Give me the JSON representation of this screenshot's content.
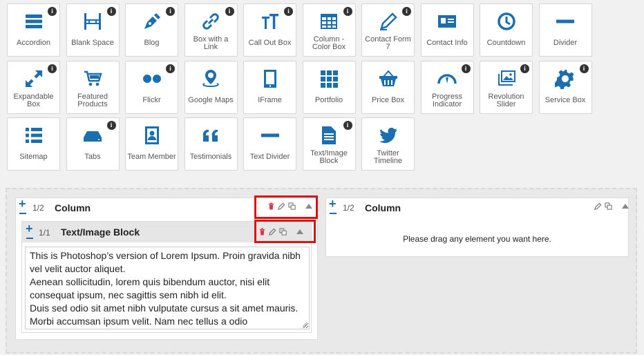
{
  "palette": [
    {
      "label": "Accordion",
      "icon": "accordion-icon",
      "info": true
    },
    {
      "label": "Blank Space",
      "icon": "blank-space-icon",
      "info": true
    },
    {
      "label": "Blog",
      "icon": "blog-pen-icon",
      "info": true
    },
    {
      "label": "Box with a Link",
      "icon": "link-icon",
      "info": true
    },
    {
      "label": "Call Out Box",
      "icon": "text-size-icon",
      "info": true
    },
    {
      "label": "Column - Color Box",
      "icon": "table-grid-icon",
      "info": true
    },
    {
      "label": "Contact Form 7",
      "icon": "pencil-icon",
      "info": true
    },
    {
      "label": "Contact Info",
      "icon": "contact-card-icon",
      "info": false
    },
    {
      "label": "Countdown",
      "icon": "clock-icon",
      "info": false
    },
    {
      "label": "Divider",
      "icon": "minus-bar-icon",
      "info": false
    },
    {
      "label": "Expandable Box",
      "icon": "expand-arrows-icon",
      "info": true
    },
    {
      "label": "Featured Products",
      "icon": "cart-icon",
      "info": false
    },
    {
      "label": "Flickr",
      "icon": "flickr-dots-icon",
      "info": true
    },
    {
      "label": "Google Maps",
      "icon": "map-pin-icon",
      "info": false
    },
    {
      "label": "IFrame",
      "icon": "tablet-icon",
      "info": false
    },
    {
      "label": "Portfolio",
      "icon": "grid-squares-icon",
      "info": false
    },
    {
      "label": "Price Box",
      "icon": "basket-icon",
      "info": false
    },
    {
      "label": "Progress Indicator",
      "icon": "gauge-icon",
      "info": true
    },
    {
      "label": "Revolution Slider",
      "icon": "images-icon",
      "info": true
    },
    {
      "label": "Service Box",
      "icon": "gear-icon",
      "info": true
    },
    {
      "label": "Sitemap",
      "icon": "list-icon",
      "info": false
    },
    {
      "label": "Tabs",
      "icon": "drive-icon",
      "info": true
    },
    {
      "label": "Team Member",
      "icon": "person-badge-icon",
      "info": false
    },
    {
      "label": "Testimonials",
      "icon": "quote-icon",
      "info": false
    },
    {
      "label": "Text Divider",
      "icon": "minus-bar-icon",
      "info": false
    },
    {
      "label": "Text/Image Block",
      "icon": "document-icon",
      "info": true
    },
    {
      "label": "Twitter Timeline",
      "icon": "twitter-bird-icon",
      "info": false
    }
  ],
  "left_column": {
    "fraction": "1/2",
    "title": "Column"
  },
  "right_column": {
    "fraction": "1/2",
    "title": "Column",
    "empty_message": "Please drag any element you want here."
  },
  "block": {
    "fraction": "1/1",
    "title": "Text/Image Block",
    "content": "This is Photoshop’s version of Lorem Ipsum. Proin gravida nibh vel velit auctor aliquet.\nAenean sollicitudin, lorem quis bibendum auctor, nisi elit consequat ipsum, nec sagittis sem nibh id elit.\nDuis sed odio sit amet nibh vulputate cursus a sit amet mauris. Morbi accumsan ipsum velit. Nam nec tellus a odio"
  },
  "colors": {
    "accent": "#1b6fb0",
    "delete": "#e0304a",
    "highlight": "#e01010"
  }
}
